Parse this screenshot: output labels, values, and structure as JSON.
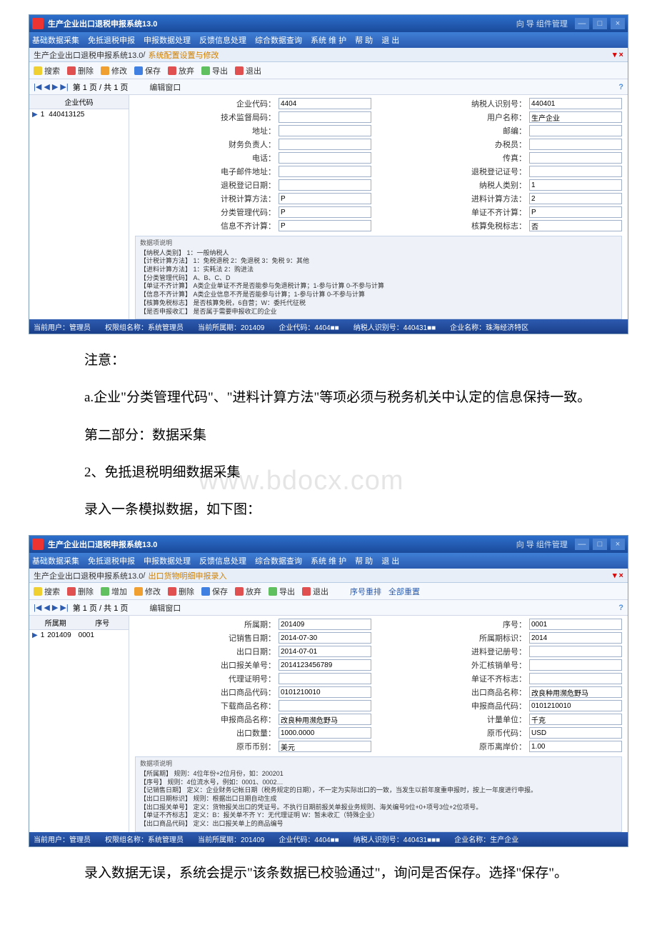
{
  "app": {
    "title": "生产企业出口退税申报系统13.0",
    "right_text": "向 导  组件管理",
    "window_buttons": [
      "—",
      "□",
      "×"
    ]
  },
  "menus_a": [
    "基础数据采集",
    "免抵退税申报",
    "申报数据处理",
    "反馈信息处理",
    "综合数据查询",
    "系统 维 护",
    "帮 助",
    "退 出"
  ],
  "menus_b": [
    "基础数据采集",
    "免抵退税申报",
    "申报数据处理",
    "反馈信息处理",
    "综合数据查询",
    "系统 维 护",
    "帮 助",
    "退 出"
  ],
  "breadcrumb_a": {
    "root": "生产企业出口退税申报系统13.0",
    "active": "系统配置设置与修改"
  },
  "breadcrumb_b": {
    "root": "生产企业出口退税申报系统13.0",
    "active": "出口货物明细申报录入"
  },
  "toolbar_a": [
    "搜索",
    "删除",
    "修改",
    "保存",
    "放弃",
    "导出",
    "退出"
  ],
  "toolbar_b": [
    "搜索",
    "删除",
    "增加",
    "修改",
    "删除",
    "保存",
    "放弃",
    "导出",
    "退出",
    "序号重排",
    "全部重置"
  ],
  "pager": {
    "label": "第 1 页 / 共 1 页",
    "edit_window": "编辑窗口",
    "help": "?"
  },
  "left_a": {
    "header": "企业代码",
    "row": {
      "seq": "1",
      "code": "440413125"
    }
  },
  "left_b": {
    "headers": [
      "所属期",
      "序号"
    ],
    "row": {
      "seq": "1",
      "period": "201409",
      "no": "0001"
    }
  },
  "form_a": {
    "fields": [
      {
        "label": "企业代码：",
        "value": "4404"
      },
      {
        "label": "纳税人识别号：",
        "value": "440401"
      },
      {
        "label": "技术监督局码：",
        "value": ""
      },
      {
        "label": "用户名称：",
        "value": "生产企业"
      },
      {
        "label": "地址：",
        "value": ""
      },
      {
        "label": "邮编：",
        "value": ""
      },
      {
        "label": "财务负责人：",
        "value": ""
      },
      {
        "label": "办税员：",
        "value": ""
      },
      {
        "label": "电话：",
        "value": ""
      },
      {
        "label": "传真：",
        "value": ""
      },
      {
        "label": "电子邮件地址：",
        "value": ""
      },
      {
        "label": "退税登记证号：",
        "value": ""
      },
      {
        "label": "退税登记日期：",
        "value": ""
      },
      {
        "label": "纳税人类别：",
        "value": "1"
      },
      {
        "label": "计税计算方法：",
        "value": "P"
      },
      {
        "label": "进料计算方法：",
        "value": "2"
      },
      {
        "label": "分类管理代码：",
        "value": "P"
      },
      {
        "label": "单证不齐计算：",
        "value": "P"
      },
      {
        "label": "信息不齐计算：",
        "value": "P"
      },
      {
        "label": "核算免税标志：",
        "value": "否"
      }
    ]
  },
  "form_b": {
    "fields": [
      {
        "label": "所属期：",
        "value": "201409"
      },
      {
        "label": "序号：",
        "value": "0001"
      },
      {
        "label": "记销售日期：",
        "value": "2014-07-30"
      },
      {
        "label": "所属期标识：",
        "value": "2014"
      },
      {
        "label": "出口日期：",
        "value": "2014-07-01"
      },
      {
        "label": "进料登记册号：",
        "value": ""
      },
      {
        "label": "出口报关单号：",
        "value": "2014123456789"
      },
      {
        "label": "外汇核销单号：",
        "value": ""
      },
      {
        "label": "代理证明号：",
        "value": ""
      },
      {
        "label": "单证不齐标志：",
        "value": ""
      },
      {
        "label": "出口商品代码：",
        "value": "0101210010"
      },
      {
        "label": "出口商品名称：",
        "value": "改良种用濒危野马"
      },
      {
        "label": "下载商品名称：",
        "value": ""
      },
      {
        "label": "申报商品代码：",
        "value": "0101210010"
      },
      {
        "label": "申报商品名称：",
        "value": "改良种用濒危野马"
      },
      {
        "label": "计量单位：",
        "value": "千克"
      },
      {
        "label": "出口数量：",
        "value": "1000.0000"
      },
      {
        "label": "原币代码：",
        "value": "USD"
      },
      {
        "label": "原币币别：",
        "value": "美元"
      },
      {
        "label": "原币离岸价：",
        "value": "1.00"
      }
    ]
  },
  "notes_a": {
    "title": "数据项说明",
    "lines": [
      "【纳税人类别】    1：一般纳税人",
      "【计税计算方法】  1：免税退税    2：免退税    3：免税    9：其他",
      "【进料计算方法】  1：实耗法    2：购进法",
      "【分类管理代码】  A、B、C、D",
      "【单证不齐计算】  A类企业单证不齐是否能参与免退税计算；1-参与计算 0-不参与计算",
      "【信息不齐计算】  A类企业信息不齐是否能参与计算；1-参与计算 0-不参与计算",
      "【核算免税标志】  是否核算免税，6自营；W：委托代征税",
      "【是否申报收汇】  是否属于需要申报收汇的企业"
    ]
  },
  "notes_b": {
    "title": "数据项说明",
    "lines": [
      "【所属期】        规则：4位年份+2位月份，如：200201",
      "【序号】          规则：4位流水号，例如：0001、0002…",
      "【记销售日期】    定义：企业财务记帐日期（税务规定的日期），不一定为实际出口的一致，当发生以前年度重申报时，按上一年度进行申报。",
      "【出口日期标识】  规则：根据出口日期自动生成",
      "【出口报关单号】  定义：货物报关出口的凭证号。不执行日期前报关单报业务规则、海关编号9位+0+项号3位+2位项号。",
      "【单证不齐标志】  定义：B：报关单不齐    Y：无代理证明    W：暂未收汇（特殊企业）",
      "【出口商品代码】  定义：出口报关单上的商品编号"
    ]
  },
  "status_a": {
    "user": "当前用户：管理员",
    "role": "权限组名称：系统管理员",
    "period": "当前所属期：201409",
    "code": "企业代码：4404■■",
    "tax": "纳税人识别号：440431■■",
    "name": "企业名称：珠海经济特区"
  },
  "status_b": {
    "user": "当前用户：管理员",
    "role": "权限组名称：系统管理员",
    "period": "当前所属期：201409",
    "code": "企业代码：4404■■",
    "tax": "纳税人识别号：440431■■■",
    "name": "企业名称：生产企业"
  },
  "doc": {
    "p_note": "注意：",
    "p_a": "a.企业\"分类管理代码\"、\"进料计算方法\"等项必须与税务机关中认定的信息保持一致。",
    "p_part2": "第二部分：数据采集",
    "p_2": "2、免抵退税明细数据采集",
    "watermark": "www.bdocx.com",
    "p_input": "录入一条模拟数据，如下图：",
    "p_save": "录入数据无误，系统会提示\"该条数据已校验通过\"，询问是否保存。选择\"保存\"。"
  }
}
